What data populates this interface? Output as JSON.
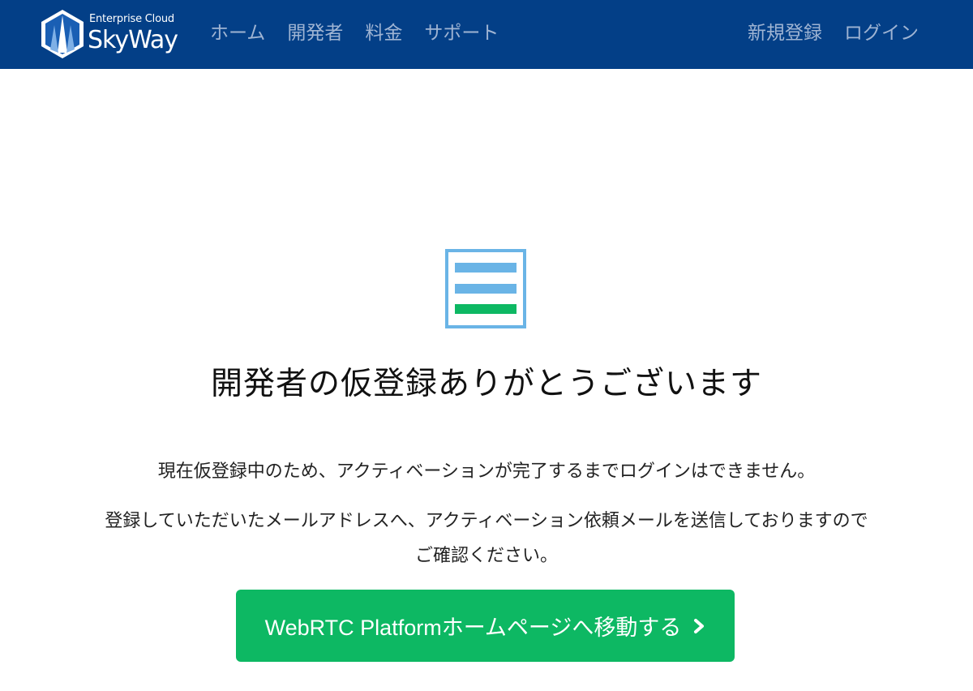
{
  "header": {
    "logo": {
      "small_text": "Enterprise Cloud",
      "big_text": "SkyWay"
    },
    "nav_left": [
      {
        "label": "ホーム"
      },
      {
        "label": "開発者"
      },
      {
        "label": "料金"
      },
      {
        "label": "サポート"
      }
    ],
    "nav_right": [
      {
        "label": "新規登録"
      },
      {
        "label": "ログイン"
      }
    ],
    "colors": {
      "bar": "#033f87",
      "link": "#9fb4d3"
    }
  },
  "main": {
    "icon": "form-icon",
    "title": "開発者の仮登録ありがとうございます",
    "message_1": "現在仮登録中のため、アクティベーションが完了するまでログインはできません。",
    "message_2_line1": "登録していただいたメールアドレスへ、アクティベーション依頼メールを送信しておりますので",
    "message_2_line2": "ご確認ください。",
    "button": {
      "label": "WebRTC Platformホームページへ移動する",
      "icon": "chevron-right-icon",
      "color": "#0db863"
    }
  }
}
